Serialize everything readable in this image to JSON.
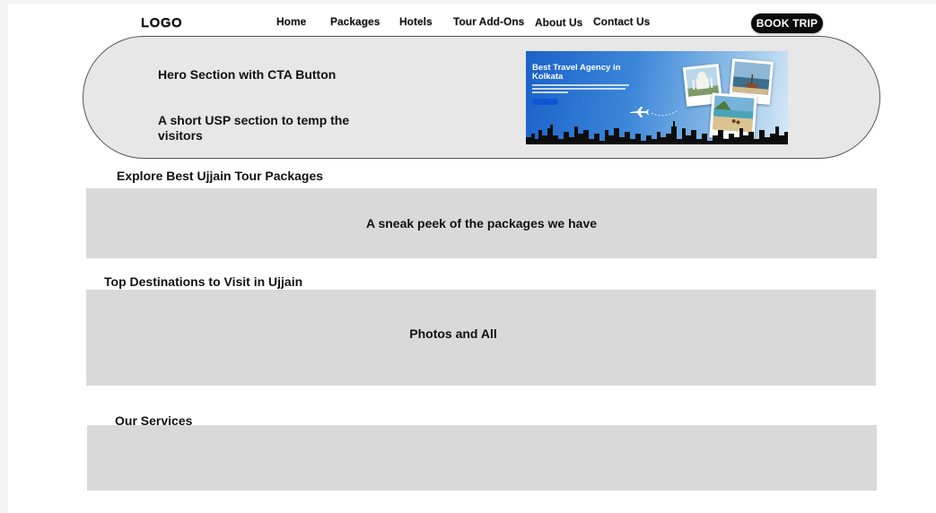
{
  "header": {
    "logo": "LOGO",
    "nav": [
      {
        "label": "Home"
      },
      {
        "label": "Packages"
      },
      {
        "label": "Hotels"
      },
      {
        "label": "Tour Add-Ons"
      },
      {
        "label": "About Us"
      },
      {
        "label": "Contact Us"
      }
    ],
    "cta_label": "BOOK TRIP"
  },
  "hero": {
    "line1": "Hero Section with CTA Button",
    "line2": "A short USP section to temp the visitors",
    "banner": {
      "title": "Best Travel Agency in Kolkata"
    }
  },
  "sections": [
    {
      "title": "Explore Best Ujjain Tour Packages",
      "placeholder": "A sneak peek of the packages we have"
    },
    {
      "title": "Top Destinations to Visit in Ujjain",
      "placeholder": "Photos and All"
    },
    {
      "title": "Our Services",
      "placeholder": ""
    }
  ],
  "colors": {
    "cta_bg": "#0b0b0b",
    "hero_bg": "#e7e7e7",
    "block_bg": "#d9d9d9",
    "banner_blue": "#1a61c9"
  }
}
